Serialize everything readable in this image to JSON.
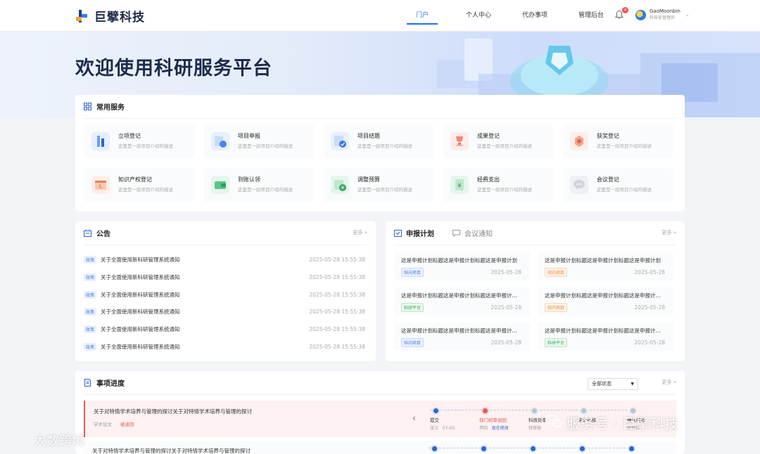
{
  "header": {
    "logo_text": "巨擘科技",
    "nav": [
      "门户",
      "个人中心",
      "代办事项",
      "管理后台"
    ],
    "bell_count": "4",
    "user_name": "GaoMoonbin",
    "user_role": "科技处管理员"
  },
  "banner": {
    "title": "欢迎使用科研服务平台"
  },
  "services": {
    "title": "常用服务",
    "items": [
      {
        "name": "立项登记",
        "desc": "这里是一段项目介绍的描述"
      },
      {
        "name": "项目申报",
        "desc": "这里是一段项目介绍的描述"
      },
      {
        "name": "项目结题",
        "desc": "这里是一段项目介绍的描述"
      },
      {
        "name": "成果登记",
        "desc": "这里是一段项目介绍的描述"
      },
      {
        "name": "获奖登记",
        "desc": "这里是一段项目介绍的描述"
      },
      {
        "name": "知识产权登记",
        "desc": "这里是一段项目介绍的描述"
      },
      {
        "name": "到账认领",
        "desc": "这里是一段项目介绍的描述"
      },
      {
        "name": "调整预算",
        "desc": "这里是一段项目介绍的描述"
      },
      {
        "name": "经费支出",
        "desc": "这里是一段项目介绍的描述"
      },
      {
        "name": "会议登记",
        "desc": "这里是一段项目介绍的描述"
      }
    ]
  },
  "notices": {
    "title": "公告",
    "more": "更多 »",
    "items": [
      {
        "tag": "政策",
        "title": "关于全面使用新科研管理系统通知",
        "time": "2025-05-28 15:55:38"
      },
      {
        "tag": "政策",
        "title": "关于全面使用新科研管理系统通知",
        "time": "2025-05-28 15:55:38"
      },
      {
        "tag": "政策",
        "title": "关于全面使用新科研管理系统通知",
        "time": "2025-05-28 15:55:38"
      },
      {
        "tag": "政策",
        "title": "关于全面使用新科研管理系统通知",
        "time": "2025-05-28 15:55:38"
      },
      {
        "tag": "政策",
        "title": "关于全面使用新科研管理系统通知",
        "time": "2025-05-28 15:55:38"
      },
      {
        "tag": "政策",
        "title": "关于全面使用新科研管理系统通知",
        "time": "2025-05-28 15:55:38"
      }
    ]
  },
  "plans": {
    "tab_active": "申报计划",
    "tab_other": "会议通知",
    "more": "更多 »",
    "items": [
      {
        "title": "这是申报计划标题这是申报计划标题这是申报计划",
        "tag": "纵向项目",
        "date": "2025-05-28"
      },
      {
        "title": "这是申报计划标题这是申报计划标题这是申报计划",
        "tag": "校内项目",
        "date": "2025-05-28"
      },
      {
        "title": "这是申报计划标题这是申报计划标题这是申报计...",
        "tag": "科研平台",
        "date": "2025-05-28"
      },
      {
        "title": "这是申报计划标题这是申报计划标题这是申报计...",
        "tag": "校内项目",
        "date": "2025-05-28"
      },
      {
        "title": "这是申报计划标题这是申报计划标题这是申报计...",
        "tag": "纵向项目",
        "date": "2025-05-28"
      },
      {
        "title": "这是申报计划标题这是申报计划标题这是申报计...",
        "tag": "科研平台",
        "date": "2025-05-28"
      }
    ]
  },
  "progress": {
    "title": "事项进度",
    "filter": "全部状态",
    "more": "更多 »",
    "row1": {
      "title": "关于对特情学术培养与管理的探讨关于对特情学术培养与管理的探讨",
      "category": "学术论文",
      "status": "被退回"
    },
    "row2_title": "关于对特情学术培养与管理的探讨关于对特情学术培养与管理的探讨",
    "steps": [
      {
        "name": "提交",
        "sub1": "张三",
        "sub2": "07-03"
      },
      {
        "name": "部门初审退回",
        "sub1": "李四",
        "sub2": "现在修改"
      },
      {
        "name": "科技处审",
        "sub1": "待审核",
        "sub2": ""
      },
      {
        "name": "学术审核",
        "sub1": "",
        "sub2": ""
      },
      {
        "name": "确认结题",
        "sub1": "待审核",
        "sub2": ""
      }
    ]
  },
  "watermark": {
    "left": "大数跨境",
    "right": "服务号 · 巨擘科技"
  },
  "colors": {
    "accent": "#1f6bff",
    "danger": "#e05c5c"
  }
}
